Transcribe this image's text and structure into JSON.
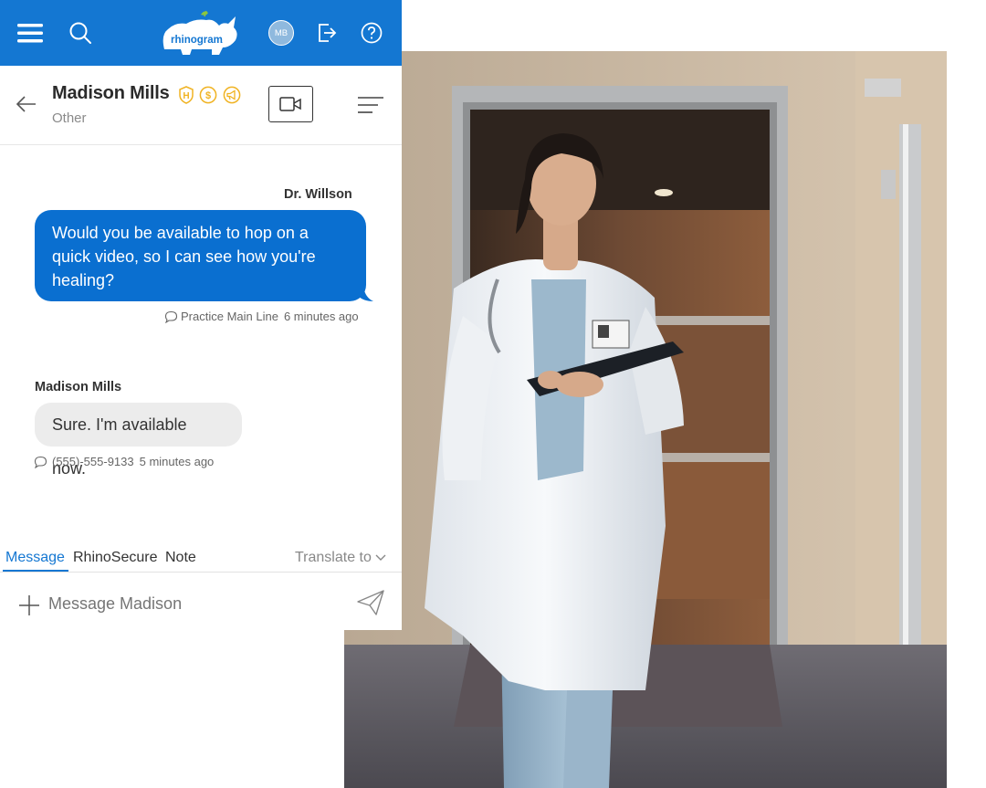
{
  "topbar": {
    "brand": "rhinogram",
    "avatar_initials": "MB",
    "icons": [
      "menu-icon",
      "search-icon",
      "logout-icon",
      "help-icon"
    ],
    "color": "#1477d2"
  },
  "contact": {
    "name": "Madison Mills",
    "subtitle": "Other",
    "badges": [
      "H",
      "$",
      "megaphone"
    ],
    "badge_color": "#f0b323"
  },
  "messages": {
    "outgoing": {
      "sender": "Dr. Willson",
      "lines": [
        "Would you be available to hop on a",
        "quick video, so I can see how you're",
        "healing?"
      ],
      "channel": "Practice Main Line",
      "time": "6 minutes ago",
      "color": "#0a6fd0"
    },
    "incoming": {
      "sender": "Madison Mills",
      "text": "Sure. I'm available now.",
      "channel": "(555)-555-9133",
      "time": "5 minutes ago",
      "color": "#ececec"
    }
  },
  "composer": {
    "tabs": [
      "Message",
      "RhinoSecure",
      "Note"
    ],
    "active_tab": "Message",
    "translate_label": "Translate to",
    "placeholder": "Message Madison"
  }
}
